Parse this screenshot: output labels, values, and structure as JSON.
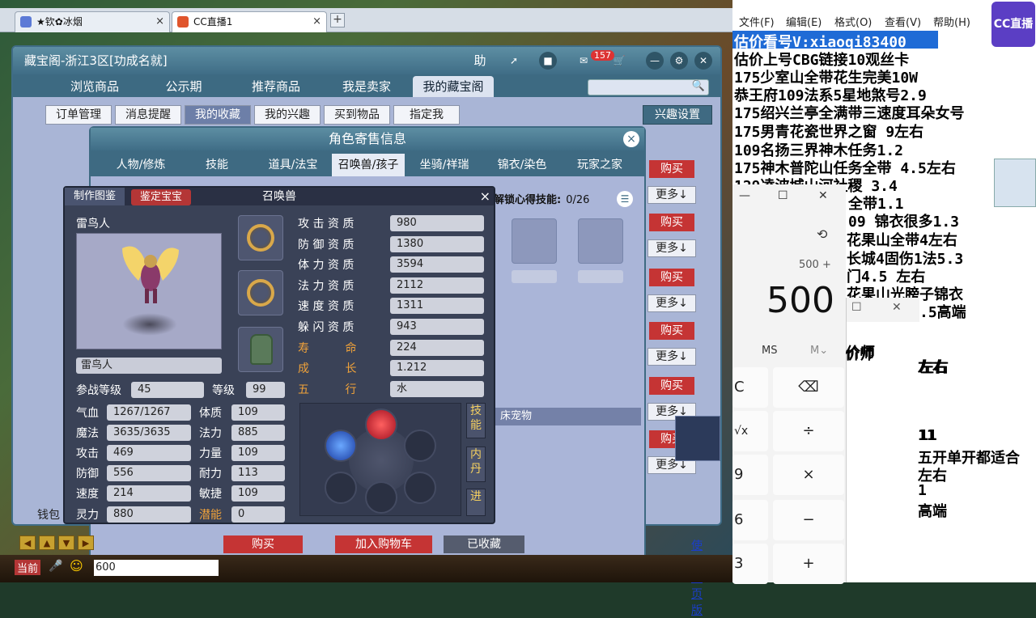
{
  "browser": {
    "tabs": [
      {
        "label": "★钦✿冰烟",
        "close": "×"
      },
      {
        "label": "CC直播1",
        "close": "×"
      }
    ],
    "new_tab": "+"
  },
  "main_window": {
    "title": "藏宝阁-浙江3区[功成名就]",
    "header_buttons": {
      "help": "助",
      "badge": "157"
    },
    "nav_tabs": [
      "浏览商品",
      "公示期",
      "推荐商品",
      "我是卖家",
      "我的藏宝阁"
    ],
    "sub_buttons": [
      "订单管理",
      "消息提醒",
      "我的收藏",
      "我的兴趣",
      "买到物品",
      "指定我"
    ],
    "interest_setting": "兴趣设置",
    "buy": "购买",
    "more": "更多↓",
    "money_label": "钱包"
  },
  "role_dialog": {
    "title": "角色寄售信息",
    "close": "×",
    "tabs": [
      "人物/修炼",
      "技能",
      "道具/法宝",
      "召唤兽/孩子",
      "坐骑/祥瑞",
      "锦衣/染色",
      "玩家之家"
    ],
    "skill_header": "解锁心得技能:",
    "skill_count": "0/26",
    "pet_label": "床宠物",
    "bottom_buttons": {
      "buy": "购买",
      "cart": "加入购物车",
      "favorited": "已收藏",
      "web": "使用网页版"
    }
  },
  "pet_dialog": {
    "title": "召唤兽",
    "close": "×",
    "make_btn": "制作图鉴",
    "identify_btn": "鉴定宝宝",
    "name": "雷鸟人",
    "name_field": "雷鸟人",
    "battle_level_label": "参战等级",
    "battle_level": "45",
    "level_label": "等级",
    "level": "99",
    "stats": [
      {
        "label": "气血",
        "value": "1267/1267",
        "label2": "体质",
        "value2": "109"
      },
      {
        "label": "魔法",
        "value": "3635/3635",
        "label2": "法力",
        "value2": "885"
      },
      {
        "label": "攻击",
        "value": "469",
        "label2": "力量",
        "value2": "109"
      },
      {
        "label": "防御",
        "value": "556",
        "label2": "耐力",
        "value2": "113"
      },
      {
        "label": "速度",
        "value": "214",
        "label2": "敏捷",
        "value2": "109"
      },
      {
        "label": "灵力",
        "value": "880",
        "label2": "潜能",
        "value2": "0"
      }
    ],
    "qualities": [
      {
        "label": "攻 击 资 质",
        "value": "980"
      },
      {
        "label": "防 御 资 质",
        "value": "1380"
      },
      {
        "label": "体 力 资 质",
        "value": "3594"
      },
      {
        "label": "法 力 资 质",
        "value": "2112"
      },
      {
        "label": "速 度 资 质",
        "value": "1311"
      },
      {
        "label": "躲 闪 资 质",
        "value": "943"
      },
      {
        "label": "寿          命",
        "value": "224"
      },
      {
        "label": "成          长",
        "value": "1.212"
      },
      {
        "label": "五          行",
        "value": "水"
      }
    ],
    "side_buttons": [
      "技能",
      "内丹",
      "进"
    ]
  },
  "game_bar": {
    "current": "当前",
    "input_value": "600"
  },
  "notepad": {
    "menu": [
      "文件(F)",
      "编辑(E)",
      "格式(O)",
      "查看(V)",
      "帮助(H)"
    ],
    "lines": [
      "估价看号V:xiaoqi83400",
      "估价上号CBG链接10观丝卡",
      "175少室山全带花生完美10W",
      "恭王府109法系5星地煞号2.9",
      "175绍兴兰亭全满带三速度耳朵女号",
      "175男青花瓷世界之窗  9左右",
      "109名扬三界神木任务1.2",
      "175神木普陀山任务全带 4.5左右",
      "129凌波城山河社稷  3.4"
    ],
    "right_lines": [
      "全带1.1",
      "09   锦衣很多1.3",
      "花果山全带4左右",
      "长城4固伤1法5.3",
      "门4.5  左右",
      "花果山光膀子锦衣",
      ".5高端"
    ],
    "lower_lines": [
      "价师",
      "左右",
      "11",
      "五开单开都适合",
      "左右",
      "1",
      "高端"
    ],
    "live_badge": "CC直播"
  },
  "calculator": {
    "expression": "500 +",
    "display": "500",
    "ms": "MS",
    "m_down": "M⌄",
    "keys": [
      "C",
      "⌫",
      "√x",
      "÷",
      "9",
      "×",
      "6",
      "−",
      "3",
      "+"
    ]
  }
}
